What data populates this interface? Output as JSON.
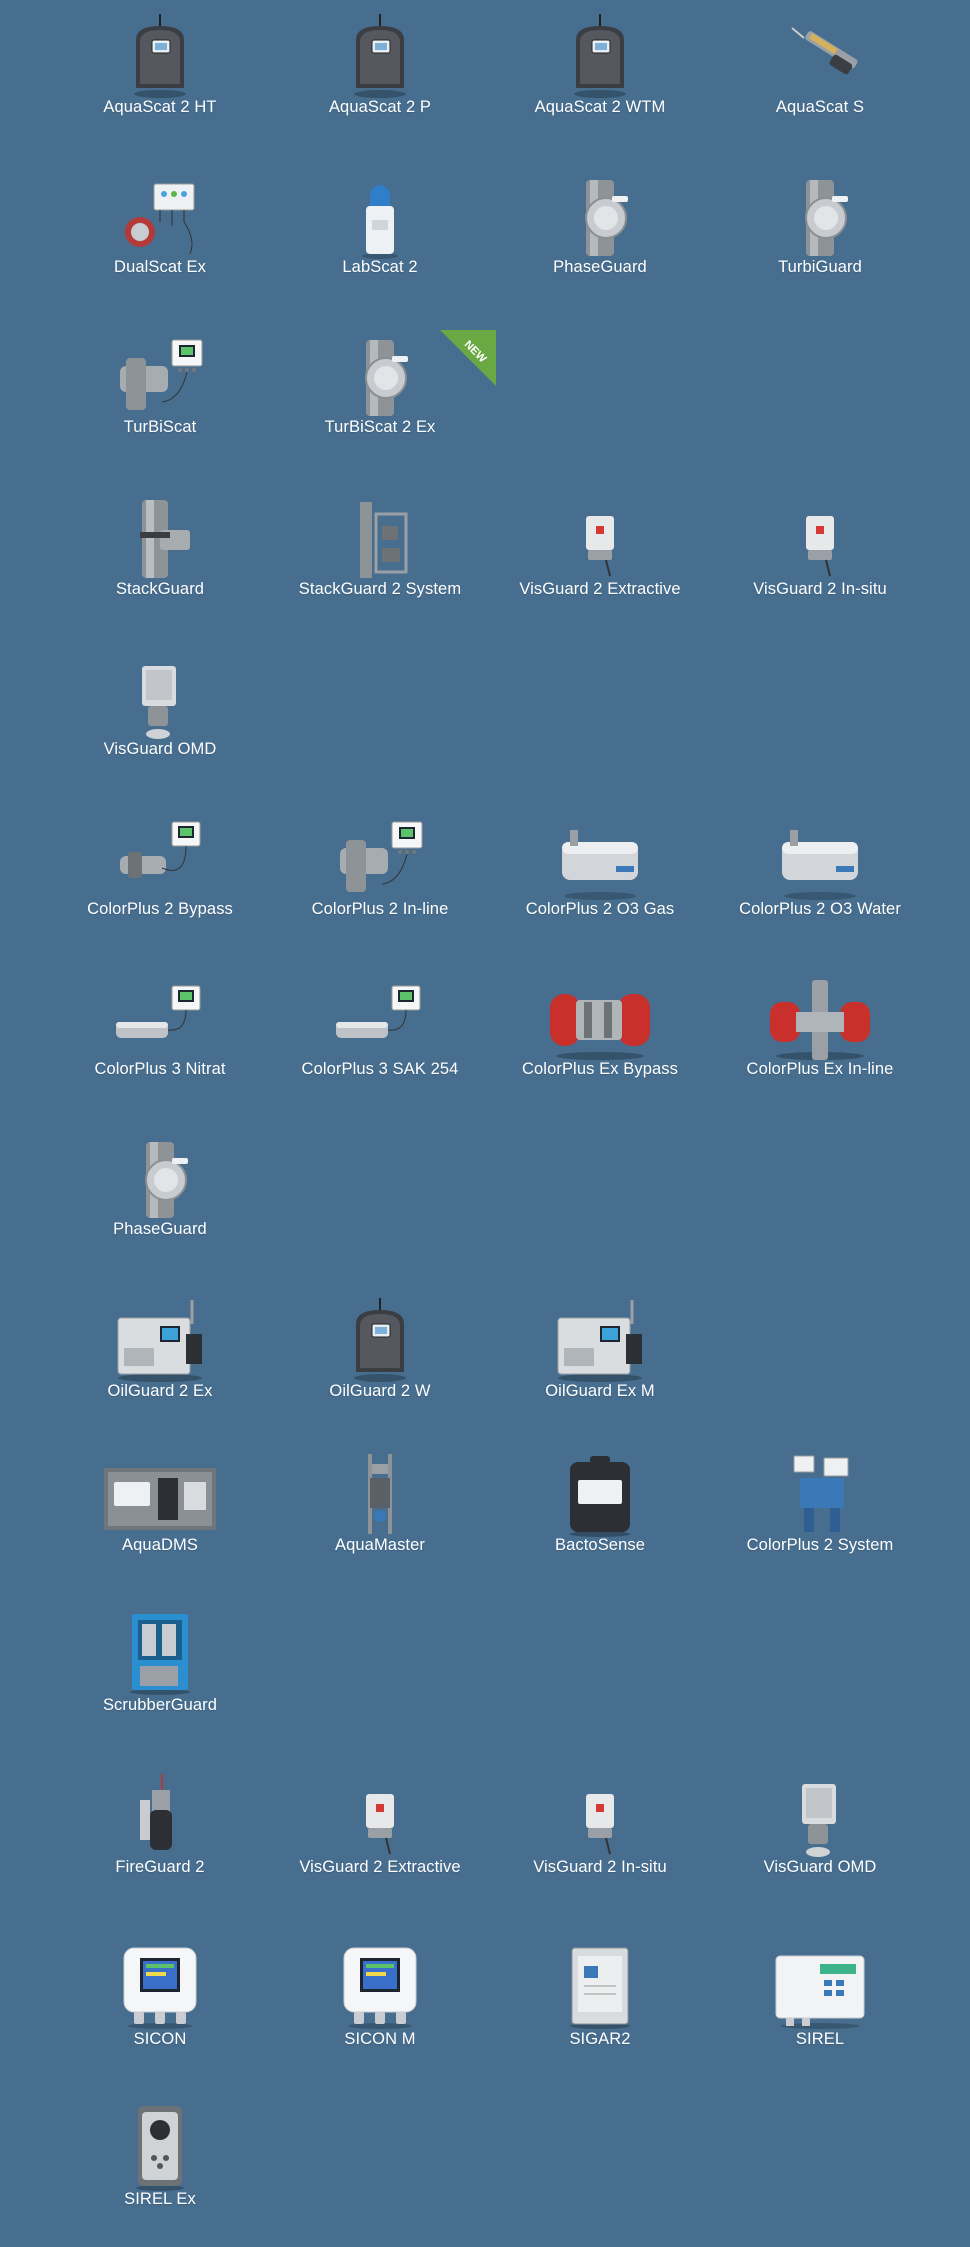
{
  "colors": {
    "background": "#476e8f",
    "label": "#ffffff",
    "new_badge": "#6aa843"
  },
  "products": [
    {
      "label": "AquaScat 2 HT",
      "icon": "aquascat-analyzer-icon"
    },
    {
      "label": "AquaScat 2 P",
      "icon": "aquascat-analyzer-icon"
    },
    {
      "label": "AquaScat 2 WTM",
      "icon": "aquascat-analyzer-icon"
    },
    {
      "label": "AquaScat S",
      "icon": "probe-sensor-icon"
    },
    {
      "label": "DualScat Ex",
      "icon": "dualscat-unit-icon"
    },
    {
      "label": "LabScat 2",
      "icon": "lab-bottle-icon"
    },
    {
      "label": "PhaseGuard",
      "icon": "inline-sensor-icon"
    },
    {
      "label": "TurbiGuard",
      "icon": "inline-sensor-icon"
    },
    {
      "label": "TurBiScat",
      "icon": "inline-sensor-with-controller-icon"
    },
    {
      "label": "TurBiScat 2 Ex",
      "icon": "inline-sensor-icon",
      "badge": "NEW"
    },
    {
      "label": "StackGuard",
      "icon": "tee-fitting-icon"
    },
    {
      "label": "StackGuard 2 System",
      "icon": "stack-system-icon"
    },
    {
      "label": "VisGuard 2 Extractive",
      "icon": "visguard-housing-icon"
    },
    {
      "label": "VisGuard 2 In-situ",
      "icon": "visguard-housing-icon"
    },
    {
      "label": "VisGuard OMD",
      "icon": "visguard-omd-icon"
    },
    {
      "label": "ColorPlus 2 Bypass",
      "icon": "sensor-with-controller-icon"
    },
    {
      "label": "ColorPlus 2 In-line",
      "icon": "inline-sensor-with-controller-icon"
    },
    {
      "label": "ColorPlus 2 O3 Gas",
      "icon": "photometer-cell-icon"
    },
    {
      "label": "ColorPlus 2 O3 Water",
      "icon": "photometer-cell-icon"
    },
    {
      "label": "ColorPlus 3 Nitrat",
      "icon": "probe-with-controller-icon"
    },
    {
      "label": "ColorPlus 3 SAK 254",
      "icon": "probe-with-controller-icon"
    },
    {
      "label": "ColorPlus Ex Bypass",
      "icon": "ex-photometer-icon"
    },
    {
      "label": "ColorPlus Ex In-line",
      "icon": "ex-photometer-inline-icon"
    },
    {
      "label": "PhaseGuard",
      "icon": "inline-sensor-icon"
    },
    {
      "label": "OilGuard 2 Ex",
      "icon": "cabinet-analyzer-icon"
    },
    {
      "label": "OilGuard 2 W",
      "icon": "aquascat-analyzer-icon"
    },
    {
      "label": "OilGuard Ex M",
      "icon": "cabinet-analyzer-icon"
    },
    {
      "label": "AquaDMS",
      "icon": "panel-system-icon"
    },
    {
      "label": "AquaMaster",
      "icon": "aquamaster-rig-icon"
    },
    {
      "label": "BactoSense",
      "icon": "bactosense-device-icon"
    },
    {
      "label": "ColorPlus 2 System",
      "icon": "colorplus-system-icon"
    },
    {
      "label": "ScrubberGuard",
      "icon": "scrubber-cabinet-icon"
    },
    {
      "label": "FireGuard 2",
      "icon": "fireguard-detector-icon"
    },
    {
      "label": "VisGuard 2 Extractive",
      "icon": "visguard-housing-icon"
    },
    {
      "label": "VisGuard 2 In-situ",
      "icon": "visguard-housing-icon"
    },
    {
      "label": "VisGuard OMD",
      "icon": "visguard-omd-icon"
    },
    {
      "label": "SICON",
      "icon": "controller-display-icon"
    },
    {
      "label": "SICON M",
      "icon": "controller-display-icon"
    },
    {
      "label": "SIGAR2",
      "icon": "sigar-cabinet-icon"
    },
    {
      "label": "SIREL",
      "icon": "sirel-box-icon"
    },
    {
      "label": "SIREL Ex",
      "icon": "sirel-ex-icon"
    }
  ]
}
